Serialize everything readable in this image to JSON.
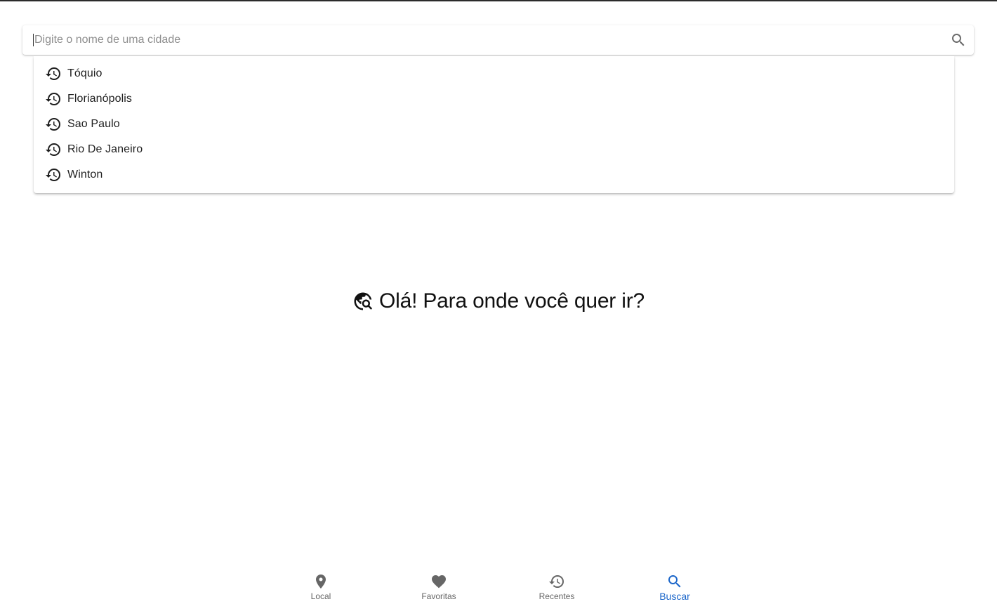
{
  "search": {
    "placeholder": "Digite o nome de uma cidade",
    "value": "",
    "icon": "search-icon"
  },
  "suggestions": [
    {
      "label": "Tóquio",
      "icon": "history-icon"
    },
    {
      "label": "Florianópolis",
      "icon": "history-icon"
    },
    {
      "label": "Sao Paulo",
      "icon": "history-icon"
    },
    {
      "label": "Rio De Janeiro",
      "icon": "history-icon"
    },
    {
      "label": "Winton",
      "icon": "history-icon"
    }
  ],
  "greeting": {
    "icon": "travel-explore-icon",
    "text": "Olá! Para onde você quer ir?"
  },
  "bottom_nav": {
    "items": [
      {
        "label": "Local",
        "icon": "location-pin-icon",
        "active": false
      },
      {
        "label": "Favoritas",
        "icon": "heart-icon",
        "active": false
      },
      {
        "label": "Recentes",
        "icon": "history-icon",
        "active": false
      },
      {
        "label": "Buscar",
        "icon": "search-icon",
        "active": true
      }
    ]
  },
  "colors": {
    "accent": "#1a65c9",
    "icon_default": "#666666",
    "text_primary": "#1f1f1f",
    "placeholder": "#8e8e8e"
  }
}
